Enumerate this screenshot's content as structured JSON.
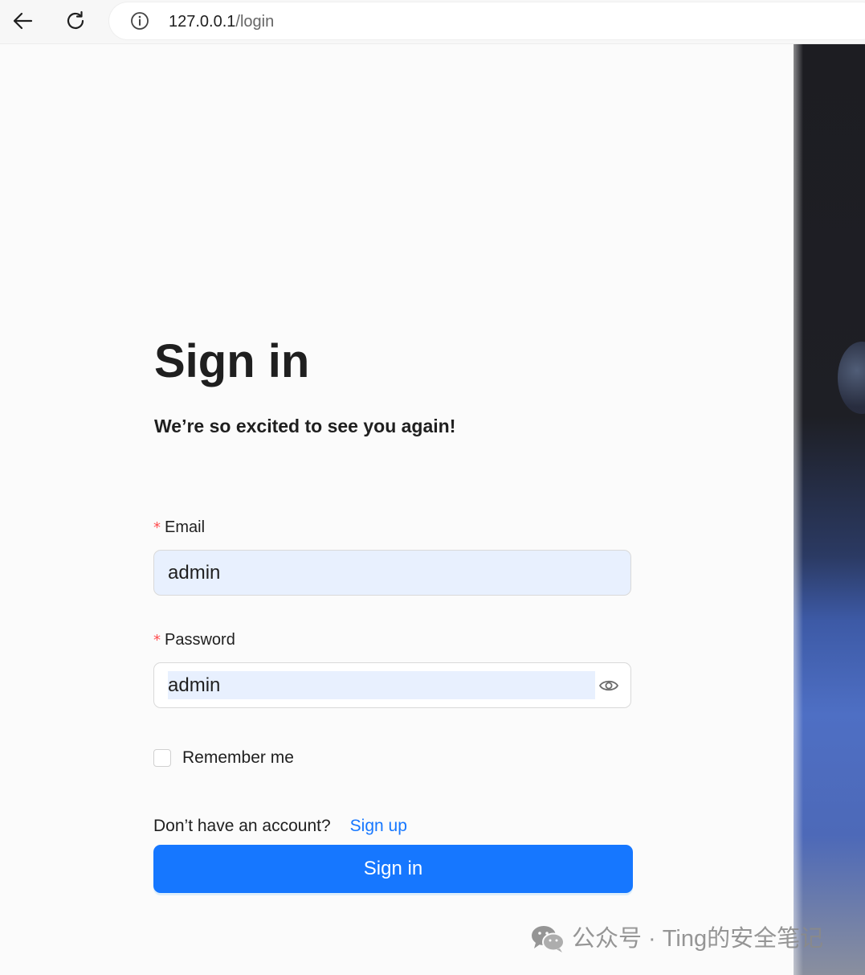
{
  "browser": {
    "url_host": "127.0.0.1",
    "url_path": "/login"
  },
  "form": {
    "title": "Sign in",
    "subtitle": "We’re so excited to see you again!",
    "email_label": "Email",
    "email_value": "admin",
    "password_label": "Password",
    "password_value": "admin",
    "required_marker": "*",
    "remember_label": "Remember me",
    "no_account_text": "Don’t have an account?",
    "signup_link": "Sign up",
    "submit_label": "Sign in"
  },
  "watermark": {
    "text": "公众号 · Ting的安全笔记"
  },
  "icons": {
    "back": "arrow-left-icon",
    "reload": "reload-icon",
    "info": "info-icon",
    "eye": "eye-icon",
    "wechat": "wechat-logo"
  },
  "colors": {
    "primary": "#1677ff",
    "required": "#ff4d4f",
    "autofill": "#e8f0fe"
  }
}
